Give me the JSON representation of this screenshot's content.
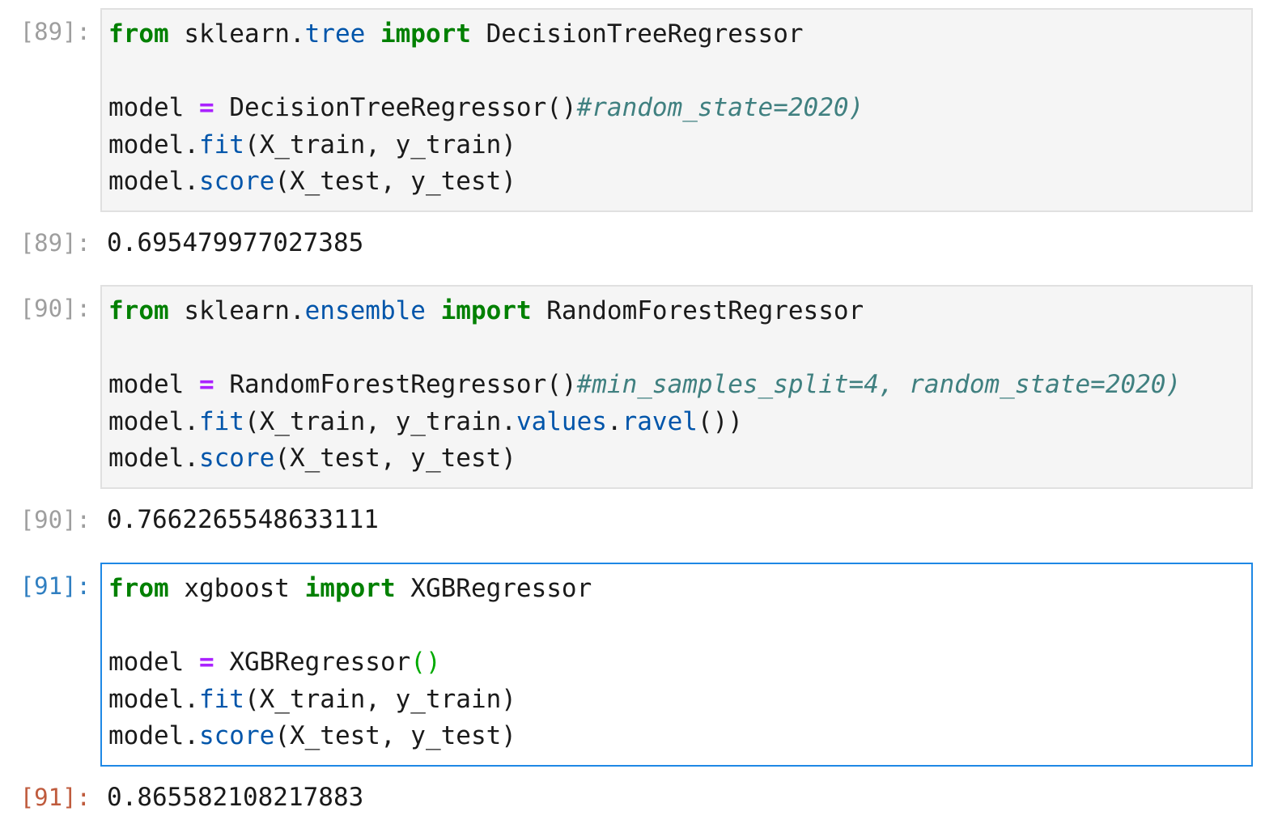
{
  "cells": [
    {
      "in_prompt": "[89]:",
      "out_prompt": "[89]:",
      "output": "0.695479977027385",
      "code": {
        "l1": [
          "from",
          " sklearn.",
          "tree",
          " ",
          "import",
          " DecisionTreeRegressor"
        ],
        "l3": [
          "model ",
          "=",
          " DecisionTreeRegressor()",
          "#random_state=2020)"
        ],
        "l4": [
          "model.",
          "fit",
          "(X_train, y_train)"
        ],
        "l5": [
          "model.",
          "score",
          "(X_test, y_test)"
        ]
      }
    },
    {
      "in_prompt": "[90]:",
      "out_prompt": "[90]:",
      "output": "0.7662265548633111",
      "code": {
        "l1": [
          "from",
          " sklearn.",
          "ensemble",
          " ",
          "import",
          " RandomForestRegressor"
        ],
        "l3": [
          "model ",
          "=",
          " RandomForestRegressor()",
          "#min_samples_split=4, random_state=2020)"
        ],
        "l4": [
          "model.",
          "fit",
          "(X_train, y_train.",
          "values",
          ".",
          "ravel",
          "())"
        ],
        "l5": [
          "model.",
          "score",
          "(X_test, y_test)"
        ]
      }
    },
    {
      "in_prompt": "[91]:",
      "out_prompt": "[91]:",
      "output": "0.865582108217883",
      "code": {
        "l1": [
          "from",
          " xgboost ",
          "import",
          " XGBRegressor"
        ],
        "l3": [
          "model ",
          "=",
          " XGBRegressor",
          "()"
        ],
        "l4": [
          "model.",
          "fit",
          "(X_train, y_train)"
        ],
        "l5": [
          "model.",
          "score",
          "(X_test, y_test)"
        ]
      }
    }
  ],
  "colors": {
    "keyword": "#008000",
    "operator": "#aa22ff",
    "attribute": "#0055aa",
    "comment": "#408080",
    "active_in_prompt": "#307fc1",
    "active_out_prompt": "#bf5b3d",
    "active_border": "#1e88e5"
  }
}
